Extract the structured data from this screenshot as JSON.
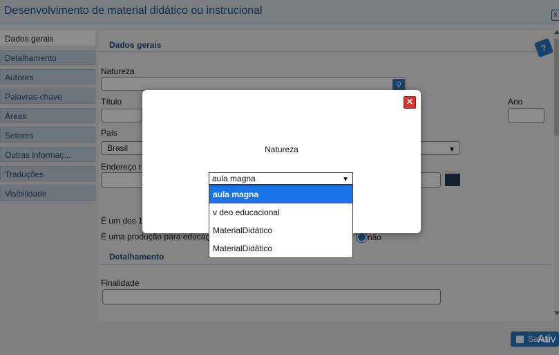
{
  "window": {
    "title": "Desenvolvimento de material didático ou instrucional"
  },
  "sidebar": {
    "items": [
      {
        "label": "Dados gerais",
        "active": true
      },
      {
        "label": "Detalhamento"
      },
      {
        "label": "Autores"
      },
      {
        "label": "Palavras-chave"
      },
      {
        "label": "Áreas"
      },
      {
        "label": "Setores"
      },
      {
        "label": "Outras informaç..."
      },
      {
        "label": "Traduções"
      },
      {
        "label": "Visibilidade"
      }
    ]
  },
  "form": {
    "section_general": "Dados gerais",
    "natureza_label": "Natureza",
    "titulo_label": "Título",
    "ano_label": "Ano",
    "pais_label": "País",
    "pais_value": "Brasil",
    "endereco_label": "Endereço r",
    "question1": "É um dos 1",
    "question2": "É uma produção para educaç",
    "radio_no": "não",
    "section_detail": "Detalhamento",
    "finalidade_label": "Finalidade",
    "save_label": "Salvar",
    "watermark": "Ativ"
  },
  "modal": {
    "title": "Natureza",
    "select_value": "aula magna",
    "options": [
      "aula magna",
      "v deo educacional",
      "MaterialDidático",
      "MaterialDidático"
    ],
    "selected_index": 0
  },
  "colors": {
    "accent": "#2f79c0",
    "title": "#1f4f86",
    "close": "#d9342b"
  }
}
